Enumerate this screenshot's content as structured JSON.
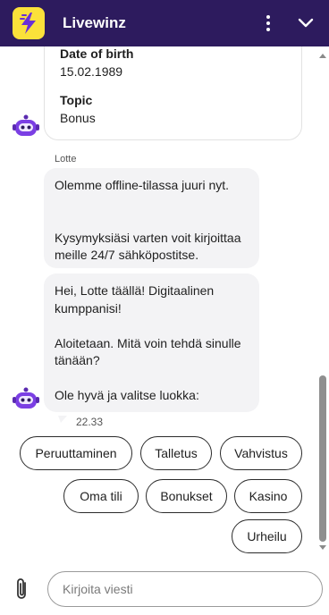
{
  "header": {
    "title": "Livewinz",
    "logo_icon": "lightning-bolt-icon",
    "menu_icon": "kebab-menu-icon",
    "collapse_icon": "chevron-down-icon",
    "background": "#2d1b5e",
    "logo_color": "#fbe13a"
  },
  "form_card": {
    "dob_label": "Date of birth",
    "dob_value": "15.02.1989",
    "topic_label": "Topic",
    "topic_value": "Bonus"
  },
  "messages": {
    "sender": "Lotte",
    "offline": "Olemme offline-tilassa juuri nyt.\n\n\nKysymyksiäsi varten voit kirjoittaa meille 24/7 sähköpostitse.",
    "greeting": "Hei, Lotte täällä! Digitaalinen kumppanisi!\n\nAloitetaan. Mitä voin tehdä sinulle tänään?\n\nOle hyvä ja valitse luokka:",
    "time": "22.33"
  },
  "quick_replies": [
    "Peruuttaminen",
    "Talletus",
    "Vahvistus",
    "Oma tili",
    "Bonukset",
    "Kasino",
    "Urheilu"
  ],
  "composer": {
    "placeholder": "Kirjoita viesti",
    "value": "",
    "attach_icon": "paperclip-icon"
  }
}
